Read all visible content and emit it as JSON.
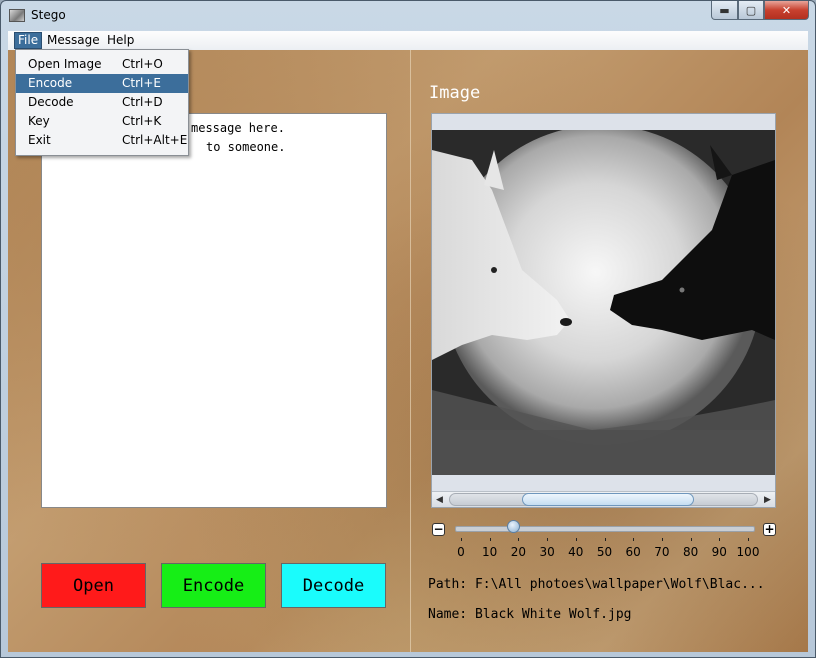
{
  "window": {
    "title": "Stego",
    "minimize": "▬",
    "maximize": "▢",
    "close": "✕"
  },
  "menubar": {
    "items": [
      "File",
      "Message",
      "Help"
    ],
    "active": "File"
  },
  "file_menu": {
    "items": [
      {
        "label": "Open Image",
        "accel": "Ctrl+O"
      },
      {
        "label": "Encode",
        "accel": "Ctrl+E",
        "highlighted": true
      },
      {
        "label": "Decode",
        "accel": "Ctrl+D"
      },
      {
        "label": "Key",
        "accel": "Ctrl+K"
      },
      {
        "label": "Exit",
        "accel": "Ctrl+Alt+E"
      }
    ]
  },
  "message": {
    "visible_lines": [
      "message here.",
      "to someone."
    ]
  },
  "buttons": {
    "open": "Open",
    "encode": "Encode",
    "decode": "Decode"
  },
  "image_panel": {
    "heading": "Image",
    "image_alt": "Black White Wolf",
    "path": "Path: F:\\All photoes\\wallpaper\\Wolf\\Blac...",
    "name": "Name: Black White Wolf.jpg"
  },
  "zoom": {
    "minus": "−",
    "plus": "+",
    "ticks": [
      "0",
      "10",
      "20",
      "30",
      "40",
      "50",
      "60",
      "70",
      "80",
      "90",
      "100"
    ],
    "value": 18
  },
  "colors": {
    "open": "#ff1a1a",
    "encode": "#16ee16",
    "decode": "#1afcfc",
    "menu_highlight": "#3c6e9b"
  }
}
